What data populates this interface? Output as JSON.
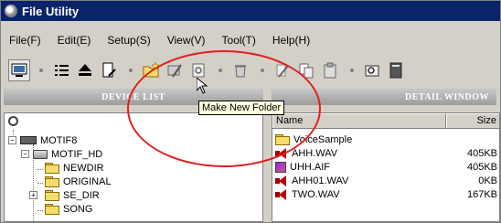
{
  "window": {
    "title": "File Utility"
  },
  "menu": [
    "File(F)",
    "Edit(E)",
    "Setup(S)",
    "View(V)",
    "Tool(T)",
    "Help(H)"
  ],
  "toolbar": {
    "icons": [
      "monitor-icon",
      "list-view-icon",
      "eject-icon",
      "document-edit-icon",
      "new-folder-icon",
      "rename-icon",
      "info-icon",
      "trash-icon",
      "cut-icon",
      "copy-icon",
      "paste-icon",
      "find-icon",
      "book-icon"
    ],
    "tooltip": "Make New Folder"
  },
  "panels": {
    "device_list": "DEVICE LIST",
    "detail_window": "DETAIL WINDOW"
  },
  "tree": {
    "device": "MOTIF8",
    "drive": "MOTIF_HD",
    "folders": [
      "NEWDIR",
      "ORIGINAL",
      "SE_DIR",
      "SONG"
    ]
  },
  "files": {
    "columns": {
      "name": "Name",
      "size": "Size"
    },
    "rows": [
      {
        "name": "VoiceSample",
        "size": "",
        "type": "folder"
      },
      {
        "name": "AHH.WAV",
        "size": "405KB",
        "type": "wav"
      },
      {
        "name": "UHH.AIF",
        "size": "405KB",
        "type": "aif"
      },
      {
        "name": "AHH01.WAV",
        "size": "0KB",
        "type": "wav"
      },
      {
        "name": "TWO.WAV",
        "size": "167KB",
        "type": "wav"
      }
    ]
  },
  "colors": {
    "titlebar": "#0a246a",
    "highlight": "#e02020",
    "tooltip_bg": "#ffffe1"
  }
}
